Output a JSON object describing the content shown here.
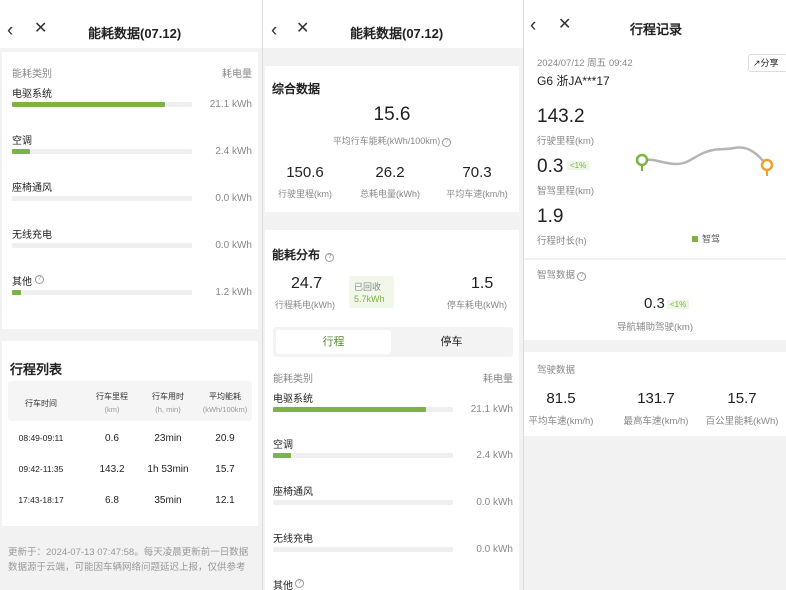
{
  "panel1": {
    "title": "能耗数据(07.12)",
    "energy_header": {
      "category": "能耗类别",
      "consumption": "耗电量"
    },
    "categories": [
      {
        "name": "电驱系统",
        "value": "21.1 kWh",
        "fraction": 0.85
      },
      {
        "name": "空调",
        "value": "2.4 kWh",
        "fraction": 0.1
      },
      {
        "name": "座椅通风",
        "value": "0.0 kWh",
        "fraction": 0
      },
      {
        "name": "无线充电",
        "value": "0.0 kWh",
        "fraction": 0
      },
      {
        "name": "其他",
        "value": "1.2 kWh",
        "fraction": 0.05
      }
    ],
    "trip_list": {
      "title": "行程列表",
      "columns": [
        {
          "name": "行车时间",
          "unit": ""
        },
        {
          "name": "行车里程",
          "unit": "(km)"
        },
        {
          "name": "行车用时",
          "unit": "(h, min)"
        },
        {
          "name": "平均能耗",
          "unit": "(kWh/100km)"
        }
      ],
      "rows": [
        [
          "08:49-09:11",
          "0.6",
          "23min",
          "20.9"
        ],
        [
          "09:42-11:35",
          "143.2",
          "1h 53min",
          "15.7"
        ],
        [
          "17:43-18:17",
          "6.8",
          "35min",
          "12.1"
        ]
      ]
    },
    "footer": {
      "line1": "更新于：2024-07-13 07:47:58。每天凌晨更新前一日数据",
      "line2": "数据源于云端，可能因车辆网络问题延迟上报，仅供参考"
    }
  },
  "panel2": {
    "title": "能耗数据(07.12)",
    "summary": {
      "title": "综合数据",
      "main_value": "15.6",
      "main_label": "平均行车能耗(kWh/100km)",
      "stats": [
        {
          "value": "150.6",
          "label": "行驶里程(km)"
        },
        {
          "value": "26.2",
          "label": "总耗电量(kWh)"
        },
        {
          "value": "70.3",
          "label": "平均车速(km/h)"
        }
      ]
    },
    "distribution": {
      "title": "能耗分布",
      "driving_value": "24.7",
      "driving_label": "行程耗电(kWh)",
      "recovered_label": "已回收",
      "recovered_value": "5.7kWh",
      "parking_value": "1.5",
      "parking_label": "停车耗电(kWh)"
    },
    "tabs": [
      {
        "label": "行程",
        "active": true
      },
      {
        "label": "停车",
        "active": false
      }
    ],
    "energy_header": {
      "category": "能耗类别",
      "consumption": "耗电量"
    },
    "categories": [
      {
        "name": "电驱系统",
        "value": "21.1 kWh",
        "fraction": 0.85
      },
      {
        "name": "空调",
        "value": "2.4 kWh",
        "fraction": 0.1
      },
      {
        "name": "座椅通风",
        "value": "0.0 kWh",
        "fraction": 0
      },
      {
        "name": "无线充电",
        "value": "0.0 kWh",
        "fraction": 0
      },
      {
        "name": "其他",
        "value": "",
        "fraction": 0
      }
    ]
  },
  "panel3": {
    "title": "行程记录",
    "datetime": "2024/07/12 周五 09:42",
    "vehicle": "G6 浙JA***17",
    "share_label": "分享",
    "stats": [
      {
        "value": "143.2",
        "label": "行驶里程(km)",
        "badge": ""
      },
      {
        "value": "0.3",
        "label": "智驾里程(km)",
        "badge": "<1%"
      },
      {
        "value": "1.9",
        "label": "行程时长(h)",
        "badge": ""
      }
    ],
    "map_legend": "智驾",
    "smart_section": {
      "title": "智驾数据",
      "value": "0.3",
      "badge": "<1%",
      "label": "导航辅助驾驶(km)"
    },
    "driving_section": {
      "title": "驾驶数据",
      "stats": [
        {
          "value": "81.5",
          "label": "平均车速(km/h)"
        },
        {
          "value": "131.7",
          "label": "最高车速(km/h)"
        },
        {
          "value": "15.7",
          "label": "百公里能耗(kWh)"
        }
      ]
    },
    "colors": {
      "accent_green": "#7cb342",
      "route_gray": "#b5b5b5",
      "end_orange": "#f0a030"
    }
  }
}
